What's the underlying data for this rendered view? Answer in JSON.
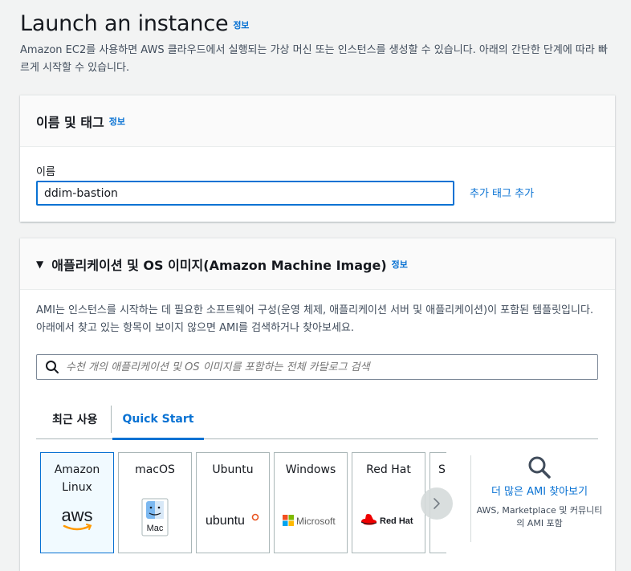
{
  "header": {
    "title": "Launch an instance",
    "info_link": "정보",
    "description": "Amazon EC2를 사용하면 AWS 클라우드에서 실행되는 가상 머신 또는 인스턴스를 생성할 수 있습니다. 아래의 간단한 단계에 따라 빠르게 시작할 수 있습니다."
  },
  "name_tags": {
    "title": "이름 및 태그",
    "info_link": "정보",
    "name_label": "이름",
    "name_value": "ddim-bastion",
    "add_tags_link": "추가 태그 추가"
  },
  "ami": {
    "title": "애플리케이션 및 OS 이미지(Amazon Machine Image)",
    "info_link": "정보",
    "description": "AMI는 인스턴스를 시작하는 데 필요한 소프트웨어 구성(운영 체제, 애플리케이션 서버 및 애플리케이션)이 포함된 템플릿입니다. 아래에서 찾고 있는 항목이 보이지 않으면 AMI를 검색하거나 찾아보세요.",
    "search_placeholder": "수천 개의 애플리케이션 및 OS 이미지를 포함하는 전체 카탈로그 검색",
    "tabs": [
      {
        "label": "최근 사용",
        "active": false
      },
      {
        "label": "Quick Start",
        "active": true
      }
    ],
    "cards": [
      {
        "label": "Amazon Linux",
        "logo": "aws-logo",
        "logo_text": "aws",
        "selected": true
      },
      {
        "label": "macOS",
        "logo": "finder-icon",
        "logo_text": "Mac",
        "selected": false
      },
      {
        "label": "Ubuntu",
        "logo": "ubuntu-logo",
        "logo_text": "ubuntu",
        "selected": false
      },
      {
        "label": "Windows",
        "logo": "microsoft-logo",
        "logo_text": "Microsoft",
        "selected": false
      },
      {
        "label": "Red Hat",
        "logo": "redhat-logo",
        "logo_text": "Red Hat",
        "selected": false
      },
      {
        "label": "SU",
        "logo": "suse-logo",
        "logo_text": "",
        "selected": false
      }
    ],
    "browse_link": "더 많은 AMI 찾아보기",
    "browse_sub": "AWS, Marketplace 및 커뮤니티의 AMI 포함"
  },
  "colors": {
    "accent": "#0972d3",
    "aws_orange": "#ff9900",
    "ubuntu_orange": "#e95420",
    "redhat_red": "#ee0000"
  }
}
